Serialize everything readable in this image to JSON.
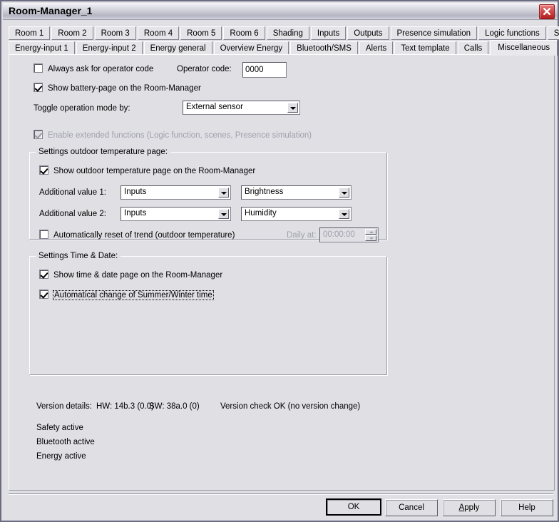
{
  "window": {
    "title": "Room-Manager_1",
    "close_icon": "close-icon",
    "accent_close": "#b02020",
    "bg": "#dfdfe4"
  },
  "tabs": {
    "row1": [
      {
        "label": "Room 1",
        "active": false
      },
      {
        "label": "Room 2",
        "active": false
      },
      {
        "label": "Room 3",
        "active": false
      },
      {
        "label": "Room 4",
        "active": false
      },
      {
        "label": "Room 5",
        "active": false
      },
      {
        "label": "Room 6",
        "active": false
      },
      {
        "label": "Shading",
        "active": false
      },
      {
        "label": "Inputs",
        "active": false
      },
      {
        "label": "Outputs",
        "active": false
      },
      {
        "label": "Presence simulation",
        "active": false
      },
      {
        "label": "Logic functions",
        "active": false
      },
      {
        "label": "Scenes",
        "active": false
      }
    ],
    "row2": [
      {
        "label": "Energy-input 1",
        "active": false
      },
      {
        "label": "Energy-input 2",
        "active": false
      },
      {
        "label": "Energy general",
        "active": false
      },
      {
        "label": "Overview Energy",
        "active": false
      },
      {
        "label": "Bluetooth/SMS",
        "active": false
      },
      {
        "label": "Alerts",
        "active": false
      },
      {
        "label": "Text template",
        "active": false
      },
      {
        "label": "Calls",
        "active": false
      },
      {
        "label": "Miscellaneous",
        "active": true
      }
    ]
  },
  "general": {
    "always_ask_label": "Always ask for operator code",
    "always_ask_checked": false,
    "operator_code_label": "Operator code:",
    "operator_code_value": "0000",
    "show_battery_label": "Show battery-page on the Room-Manager",
    "show_battery_checked": true,
    "toggle_mode_label": "Toggle operation mode by:",
    "toggle_mode_value": "External sensor",
    "enable_extended_label": "Enable extended functions (Logic function, scenes, Presence simulation)",
    "enable_extended_checked": true,
    "enable_extended_disabled": true
  },
  "outdoor": {
    "group_title": "Settings outdoor temperature page:",
    "show_page_label": "Show outdoor temperature page on the Room-Manager",
    "show_page_checked": true,
    "value1_label": "Additional value 1:",
    "value1_source": "Inputs",
    "value1_type": "Brightness",
    "value2_label": "Additional value 2:",
    "value2_source": "Inputs",
    "value2_type": "Humidity",
    "auto_reset_label": "Automatically reset of trend (outdoor temperature)",
    "auto_reset_checked": false,
    "daily_at_label": "Daily at:",
    "daily_at_value": "00:00:00",
    "daily_at_disabled": true
  },
  "timedate": {
    "group_title": "Settings Time & Date:",
    "show_page_label": "Show time & date page on the Room-Manager",
    "show_page_checked": true,
    "summer_winter_label": "Automatical change of Summer/Winter time",
    "summer_winter_checked": true,
    "summer_winter_focused": true
  },
  "version": {
    "details_label": "Version details:",
    "hw": "HW: 14b.3 (0.0)",
    "sw": "SW: 38a.0 (0)",
    "check": "Version check OK (no version change)",
    "status": [
      "Safety active",
      "Bluetooth active",
      "Energy active"
    ]
  },
  "buttons": {
    "ok": "OK",
    "cancel": "Cancel",
    "apply_pre": "A",
    "apply_post": "pply",
    "help": "Help"
  }
}
